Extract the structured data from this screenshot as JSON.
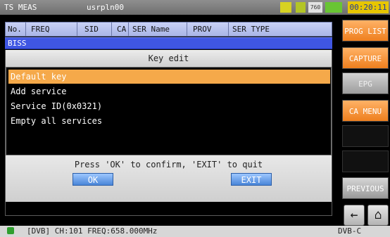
{
  "topbar": {
    "mode": "TS MEAS",
    "user": "usrpln00",
    "time": "00:20:11",
    "icons": [
      "status-icon-1",
      "status-icon-2",
      "status-icon-3",
      "battery-icon"
    ],
    "indicator_text": "760"
  },
  "table": {
    "headers": [
      "No.",
      "FREQ",
      "SID",
      "CA",
      "SER Name",
      "PROV",
      "SER TYPE"
    ]
  },
  "section": {
    "label": "BISS"
  },
  "dialog": {
    "title": "Key edit",
    "items": [
      {
        "label": "Default key",
        "selected": true
      },
      {
        "label": "Add service",
        "selected": false
      },
      {
        "label": "Service ID(0x0321)",
        "selected": false
      },
      {
        "label": "Empty all services",
        "selected": false
      }
    ],
    "message": "Press 'OK' to confirm, 'EXIT' to quit",
    "ok_label": "OK",
    "exit_label": "EXIT"
  },
  "sidebar": {
    "prog_list": "PROG LIST",
    "capture": "CAPTURE",
    "epg": "EPG",
    "ca_menu": "CA MENU",
    "previous": "PREVIOUS"
  },
  "status": {
    "text": "[DVB] CH:101 FREQ:658.000MHz",
    "mode": "DVB-C"
  },
  "colors": {
    "accent": "#ee7f1e",
    "highlight": "#3f56e3",
    "selected": "#f5a94a",
    "time_bg": "#e7c600"
  }
}
